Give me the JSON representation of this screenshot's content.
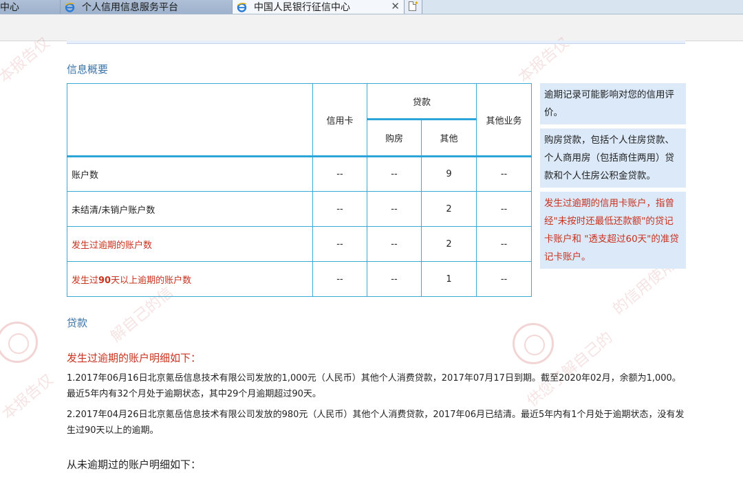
{
  "browser": {
    "tabs": [
      {
        "label": "中心",
        "active": false
      },
      {
        "label": "个人信用信息服务平台",
        "active": false
      },
      {
        "label": "中国人民银行征信中心",
        "active": true
      }
    ],
    "close_glyph": "✕"
  },
  "summary": {
    "title": "信息概要",
    "headers": {
      "credit_card": "信用卡",
      "loan": "贷款",
      "housing": "购房",
      "other": "其他",
      "other_business": "其他业务"
    },
    "rows": [
      {
        "label": "账户数",
        "credit_card": "--",
        "housing": "--",
        "other": "9",
        "other_business": "--",
        "highlight": false
      },
      {
        "label": "未结清/未销户账户数",
        "credit_card": "--",
        "housing": "--",
        "other": "2",
        "other_business": "--",
        "highlight": false
      },
      {
        "label": "发生过逾期的账户数",
        "credit_card": "--",
        "housing": "--",
        "other": "2",
        "other_business": "--",
        "highlight": true
      },
      {
        "label_prefix": "发生过",
        "label_bold": "90",
        "label_suffix": "天以上逾期的账户数",
        "credit_card": "--",
        "housing": "--",
        "other": "1",
        "other_business": "--",
        "highlight": true
      }
    ]
  },
  "notes": [
    {
      "text": "逾期记录可能影响对您的信用评价。",
      "color": "black"
    },
    {
      "text": "购房贷款，包括个人住房贷款、个人商用房（包括商住两用）贷款和个人住房公积金贷款。",
      "color": "black"
    },
    {
      "text": "发生过逾期的信用卡账户，指曾经\"未按时还最低还款额\"的贷记卡账户和 \"透支超过60天\"的准贷记卡账户。",
      "color": "red"
    }
  ],
  "loans": {
    "title": "贷款",
    "overdue_heading": "发生过逾期的账户明细如下：",
    "overdue_items": [
      "1.2017年06月16日北京氪岳信息技术有限公司发放的1,000元（人民币）其他个人消费贷款，2017年07月17日到期。截至2020年02月，余额为1,000。最近5年内有32个月处于逾期状态，其中29个月逾期超过90天。",
      "2.2017年04月26日北京氪岳信息技术有限公司发放的980元（人民币）其他个人消费贷款，2017年06月已结清。最近5年内有1个月处于逾期状态，没有发生过90天以上的逾期。"
    ],
    "no_overdue_heading": "从未逾期过的账户明细如下："
  },
  "colors": {
    "accent_blue": "#2aa4d9",
    "title_blue": "#3a73a8",
    "warning_red": "#c8321e",
    "note_bg": "#dbe9f9"
  },
  "icons": [
    "ie-icon",
    "close-icon",
    "new-tab-icon"
  ]
}
